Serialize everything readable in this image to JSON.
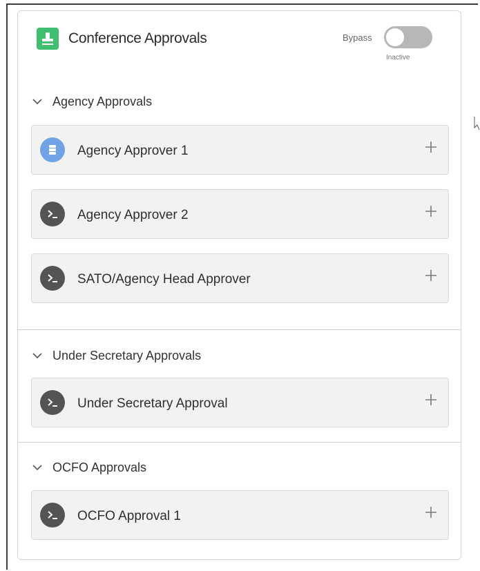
{
  "header": {
    "title": "Conference Approvals",
    "app_icon": "stamp-icon",
    "accent_color": "#3fbf6f",
    "bypass": {
      "label": "Bypass",
      "status": "Inactive",
      "on": false
    }
  },
  "sections": [
    {
      "title": "Agency Approvals",
      "expanded": true,
      "items": [
        {
          "label": "Agency Approver 1",
          "icon": "database-icon",
          "icon_color": "#6fa3e6"
        },
        {
          "label": "Agency Approver 2",
          "icon": "terminal-icon",
          "icon_color": "#545454"
        },
        {
          "label": "SATO/Agency Head Approver",
          "icon": "terminal-icon",
          "icon_color": "#545454"
        }
      ]
    },
    {
      "title": "Under Secretary Approvals",
      "expanded": true,
      "items": [
        {
          "label": "Under Secretary Approval",
          "icon": "terminal-icon",
          "icon_color": "#545454"
        }
      ]
    },
    {
      "title": "OCFO Approvals",
      "expanded": true,
      "items": [
        {
          "label": "OCFO Approval 1",
          "icon": "terminal-icon",
          "icon_color": "#545454"
        }
      ]
    }
  ]
}
